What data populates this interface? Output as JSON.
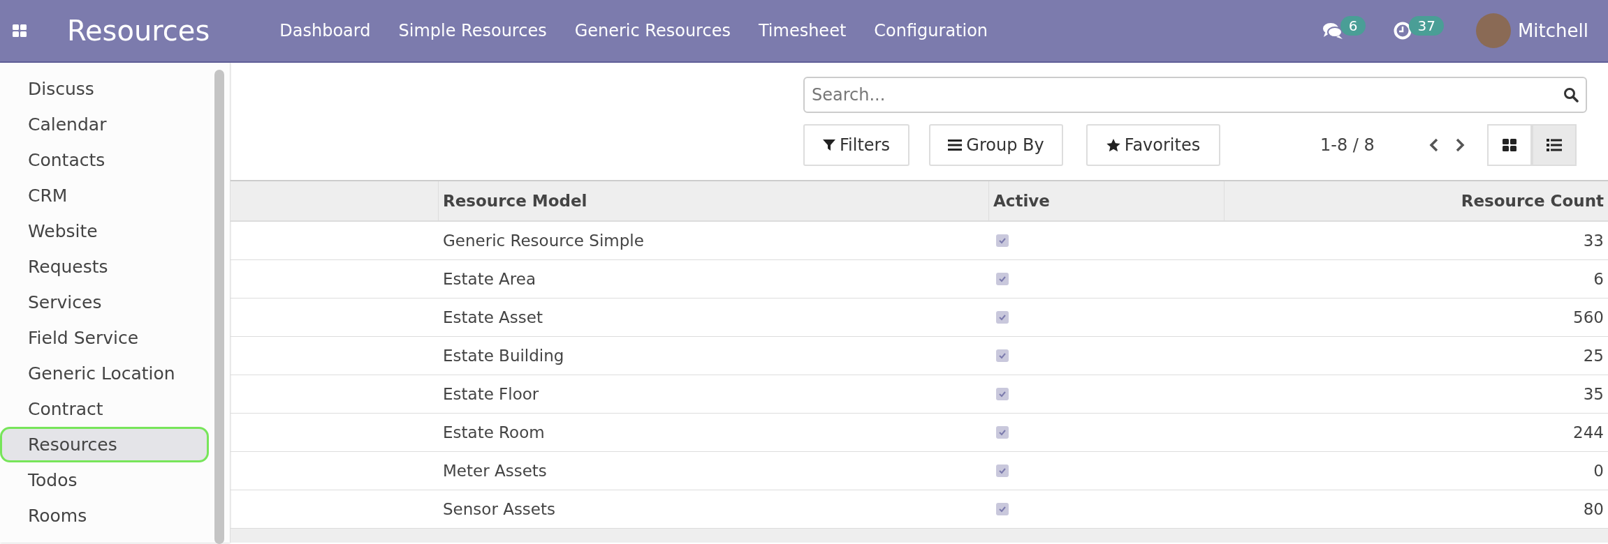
{
  "navbar": {
    "app_title": "Resources",
    "menu": [
      "Dashboard",
      "Simple Resources",
      "Generic Resources",
      "Timesheet",
      "Configuration"
    ],
    "messages_badge": "6",
    "activities_badge": "37",
    "user": "Mitchell"
  },
  "apps_menu": {
    "items": [
      {
        "label": "Discuss",
        "selected": false
      },
      {
        "label": "Calendar",
        "selected": false
      },
      {
        "label": "Contacts",
        "selected": false
      },
      {
        "label": "CRM",
        "selected": false
      },
      {
        "label": "Website",
        "selected": false
      },
      {
        "label": "Requests",
        "selected": false
      },
      {
        "label": "Services",
        "selected": false
      },
      {
        "label": "Field Service",
        "selected": false
      },
      {
        "label": "Generic Location",
        "selected": false
      },
      {
        "label": "Contract",
        "selected": false
      },
      {
        "label": "Resources",
        "selected": true
      },
      {
        "label": "Todos",
        "selected": false
      },
      {
        "label": "Rooms",
        "selected": false
      }
    ]
  },
  "search": {
    "placeholder": "Search..."
  },
  "filter_buttons": [
    "Filters",
    "Group By",
    "Favorites"
  ],
  "pager": "1-8 / 8",
  "views": [
    {
      "kind": "kanban",
      "selected": false
    },
    {
      "kind": "list",
      "selected": true
    }
  ],
  "table": {
    "columns": [
      "Resource Model",
      "Active",
      "Resource Count"
    ],
    "rows": [
      {
        "model": "Generic Resource Simple",
        "active": true,
        "count": "33"
      },
      {
        "model": "Estate Area",
        "active": true,
        "count": "6"
      },
      {
        "model": "Estate Asset",
        "active": true,
        "count": "560"
      },
      {
        "model": "Estate Building",
        "active": true,
        "count": "25"
      },
      {
        "model": "Estate Floor",
        "active": true,
        "count": "35"
      },
      {
        "model": "Estate Room",
        "active": true,
        "count": "244"
      },
      {
        "model": "Meter Assets",
        "active": true,
        "count": "0"
      },
      {
        "model": "Sensor Assets",
        "active": true,
        "count": "80"
      }
    ]
  }
}
